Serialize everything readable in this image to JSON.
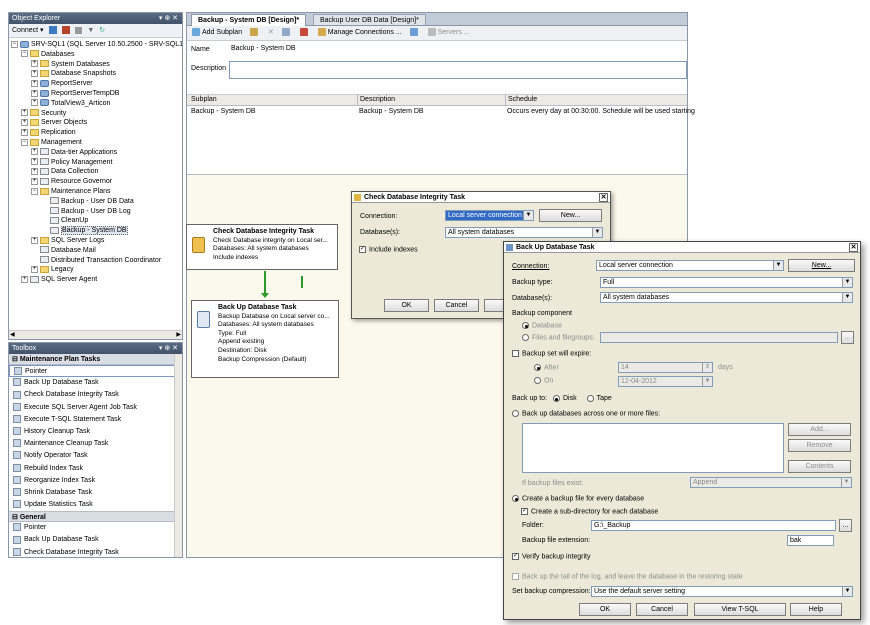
{
  "object_explorer": {
    "title": "Object Explorer",
    "pin": "▾ ⊕ ✕",
    "connect": "Connect ▾",
    "tree": [
      {
        "indent": 0,
        "exp": "−",
        "icon": "server",
        "label": "SRV-SQL1 (SQL Server 10.50.2500 - SRV-SQL1\\Sc"
      },
      {
        "indent": 1,
        "exp": "−",
        "icon": "folder",
        "label": "Databases"
      },
      {
        "indent": 2,
        "exp": "+",
        "icon": "folder",
        "label": "System Databases"
      },
      {
        "indent": 2,
        "exp": "+",
        "icon": "folder",
        "label": "Database Snapshots"
      },
      {
        "indent": 2,
        "exp": "+",
        "icon": "db",
        "label": "ReportServer"
      },
      {
        "indent": 2,
        "exp": "+",
        "icon": "db",
        "label": "ReportServerTempDB"
      },
      {
        "indent": 2,
        "exp": "+",
        "icon": "db",
        "label": "TotalView3_Articon"
      },
      {
        "indent": 1,
        "exp": "+",
        "icon": "folder",
        "label": "Security"
      },
      {
        "indent": 1,
        "exp": "+",
        "icon": "folder",
        "label": "Server Objects"
      },
      {
        "indent": 1,
        "exp": "+",
        "icon": "folder",
        "label": "Replication"
      },
      {
        "indent": 1,
        "exp": "−",
        "icon": "folder",
        "label": "Management"
      },
      {
        "indent": 2,
        "exp": "+",
        "icon": "plan",
        "label": "Data-tier Applications"
      },
      {
        "indent": 2,
        "exp": "+",
        "icon": "plan",
        "label": "Policy Management"
      },
      {
        "indent": 2,
        "exp": "+",
        "icon": "plan",
        "label": "Data Collection"
      },
      {
        "indent": 2,
        "exp": "+",
        "icon": "plan",
        "label": "Resource Governor"
      },
      {
        "indent": 2,
        "exp": "−",
        "icon": "folder",
        "label": "Maintenance Plans"
      },
      {
        "indent": 3,
        "exp": "",
        "icon": "plan",
        "label": "Backup - User DB Data"
      },
      {
        "indent": 3,
        "exp": "",
        "icon": "plan",
        "label": "Backup - User DB Log"
      },
      {
        "indent": 3,
        "exp": "",
        "icon": "plan",
        "label": "CleanUp"
      },
      {
        "indent": 3,
        "exp": "",
        "icon": "plan",
        "label": "Backup - System DB",
        "selected": true
      },
      {
        "indent": 2,
        "exp": "+",
        "icon": "folder",
        "label": "SQL Server Logs"
      },
      {
        "indent": 2,
        "exp": "",
        "icon": "plan",
        "label": "Database Mail"
      },
      {
        "indent": 2,
        "exp": "",
        "icon": "plan",
        "label": "Distributed Transaction Coordinator"
      },
      {
        "indent": 2,
        "exp": "+",
        "icon": "folder",
        "label": "Legacy"
      },
      {
        "indent": 1,
        "exp": "+",
        "icon": "plan",
        "label": "SQL Server Agent"
      }
    ]
  },
  "toolbox": {
    "title": "Toolbox",
    "pin": "▾ ⊕ ✕",
    "group1": "Maintenance Plan Tasks",
    "items1": [
      "Pointer",
      "Back Up Database Task",
      "Check Database Integrity Task",
      "Execute SQL Server Agent Job Task",
      "Execute T-SQL Statement Task",
      "History Cleanup Task",
      "Maintenance Cleanup Task",
      "Notify Operator Task",
      "Rebuild Index Task",
      "Reorganize Index Task",
      "Shrink Database Task",
      "Update Statistics Task"
    ],
    "group2": "General",
    "items2": [
      "Pointer",
      "Back Up Database Task",
      "Check Database Integrity Task"
    ]
  },
  "tabs": [
    {
      "label": "Backup - System DB [Design]*",
      "active": true
    },
    {
      "label": "Backup User DB Data [Design]*",
      "active": false
    }
  ],
  "toolbar": {
    "add_subplan": "Add Subplan",
    "manage_connections": "Manage Connections ...",
    "servers": "Servers ..."
  },
  "designer": {
    "name_label": "Name",
    "name_value": "Backup - System DB",
    "description_label": "Description",
    "grid_headers": [
      "Subplan",
      "Description",
      "Schedule"
    ],
    "grid_row": [
      "Backup - System DB",
      "Backup - System DB",
      "Occurs every day at 00:30:00. Schedule will be used starting"
    ]
  },
  "task1": {
    "title": "Check Database Integrity Task",
    "lines": [
      "Check Database integrity on Local ser...",
      "Databases: All system databases",
      "Include indexes"
    ]
  },
  "task2": {
    "title": "Back Up Database Task",
    "lines": [
      "Backup Database on Local server co...",
      "Databases: All system databases",
      "Type: Full",
      "Append existing",
      "Destination: Disk",
      "Backup Compression (Default)"
    ]
  },
  "integrity_dialog": {
    "title": "Check Database Integrity Task",
    "connection_label": "Connection:",
    "connection_value": "Local server connection",
    "new_button": "New...",
    "databases_label": "Database(s):",
    "databases_value": "All system databases",
    "include_indexes": "Include indexes",
    "ok": "OK",
    "cancel": "Cancel",
    "view_partial": "V"
  },
  "backup_dialog": {
    "title": "Back Up Database Task",
    "connection_label": "Connection:",
    "connection_value": "Local server connection",
    "new_button": "New...",
    "backup_type_label": "Backup type:",
    "backup_type_value": "Full",
    "databases_label": "Database(s):",
    "databases_value": "All system databases",
    "backup_component": "Backup component",
    "database_option": "Database",
    "files_option": "Files and filegroups:",
    "expire_label": "Backup set will expire:",
    "after_label": "After",
    "after_value": "14",
    "days": "days",
    "on_label": "On",
    "on_value": "12-04-2012",
    "backup_to_label": "Back up to:",
    "disk": "Disk",
    "tape": "Tape",
    "across_files": "Back up databases across one or more files:",
    "add": "Add...",
    "remove": "Remove",
    "contents": "Contents",
    "if_exists_label": "If backup files exist:",
    "if_exists_value": "Append",
    "create_file": "Create a backup file for every database",
    "sub_directory": "Create a sub-directory for each database",
    "folder_label": "Folder:",
    "folder_value": "G:\\_Backup",
    "browse": "...",
    "extension_label": "Backup file extension:",
    "extension_value": "bak",
    "verify": "Verify backup integrity",
    "tail_log": "Back up the tail of the log, and leave the database in the restoring state",
    "compression_label": "Set backup compression:",
    "compression_value": "Use the default server setting",
    "ok": "OK",
    "cancel": "Cancel",
    "view_tsql": "View T-SQL",
    "help": "Help"
  }
}
